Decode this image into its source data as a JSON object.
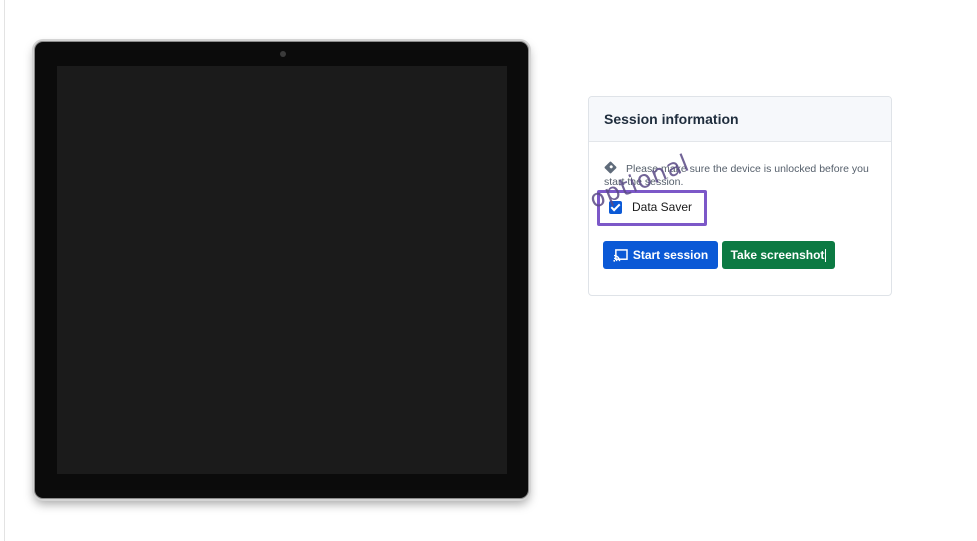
{
  "session_panel": {
    "title": "Session information",
    "note": "Please make sure the device is unlocked before you start the session.",
    "data_saver_label": "Data Saver",
    "data_saver_checked": true,
    "start_label": "Start session",
    "screenshot_label": "Take screenshot"
  },
  "annotation": {
    "text": "optional",
    "color": "#7c58c8"
  },
  "colors": {
    "primary": "#0b59d6",
    "success": "#0c7a43"
  }
}
